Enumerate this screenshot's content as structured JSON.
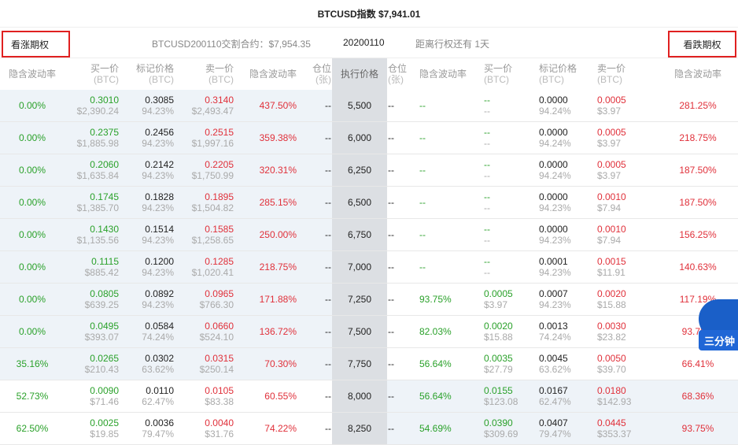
{
  "header": {
    "title": "BTCUSD指数 $7,941.01"
  },
  "sub": {
    "call_label": "看涨期权",
    "put_label": "看跌期权",
    "contract": "BTCUSD200110交割合约：$7,954.35",
    "date": "20200110",
    "remain": "距离行权还有 1天"
  },
  "columns": {
    "iv": "隐含波动率",
    "bid": "买一价",
    "bid_unit": "(BTC)",
    "mark": "标记价格",
    "mark_unit": "(BTC)",
    "ask": "卖一价",
    "ask_unit": "(BTC)",
    "iv2": "隐含波动率",
    "pos": "仓位",
    "pos_unit": "(张)",
    "strike": "执行价格"
  },
  "float": {
    "label": "三分钟"
  },
  "rows": [
    {
      "c_iv": "0.00%",
      "c_bid": "0.3010",
      "c_bid_usd": "$2,390.24",
      "c_mark": "0.3085",
      "c_mark_pct": "94.23%",
      "c_ask": "0.3140",
      "c_ask_usd": "$2,493.47",
      "c_iv2": "437.50%",
      "c_pos": "--",
      "strike": "5,500",
      "p_pos": "--",
      "p_iv": "--",
      "p_bid": "--",
      "p_bid_usd": "--",
      "p_mark": "0.0000",
      "p_mark_pct": "94.24%",
      "p_ask": "0.0005",
      "p_ask_usd": "$3.97",
      "p_iv2": "281.25%"
    },
    {
      "c_iv": "0.00%",
      "c_bid": "0.2375",
      "c_bid_usd": "$1,885.98",
      "c_mark": "0.2456",
      "c_mark_pct": "94.23%",
      "c_ask": "0.2515",
      "c_ask_usd": "$1,997.16",
      "c_iv2": "359.38%",
      "c_pos": "--",
      "strike": "6,000",
      "p_pos": "--",
      "p_iv": "--",
      "p_bid": "--",
      "p_bid_usd": "--",
      "p_mark": "0.0000",
      "p_mark_pct": "94.24%",
      "p_ask": "0.0005",
      "p_ask_usd": "$3.97",
      "p_iv2": "218.75%"
    },
    {
      "c_iv": "0.00%",
      "c_bid": "0.2060",
      "c_bid_usd": "$1,635.84",
      "c_mark": "0.2142",
      "c_mark_pct": "94.23%",
      "c_ask": "0.2205",
      "c_ask_usd": "$1,750.99",
      "c_iv2": "320.31%",
      "c_pos": "--",
      "strike": "6,250",
      "p_pos": "--",
      "p_iv": "--",
      "p_bid": "--",
      "p_bid_usd": "--",
      "p_mark": "0.0000",
      "p_mark_pct": "94.24%",
      "p_ask": "0.0005",
      "p_ask_usd": "$3.97",
      "p_iv2": "187.50%"
    },
    {
      "c_iv": "0.00%",
      "c_bid": "0.1745",
      "c_bid_usd": "$1,385.70",
      "c_mark": "0.1828",
      "c_mark_pct": "94.23%",
      "c_ask": "0.1895",
      "c_ask_usd": "$1,504.82",
      "c_iv2": "285.15%",
      "c_pos": "--",
      "strike": "6,500",
      "p_pos": "--",
      "p_iv": "--",
      "p_bid": "--",
      "p_bid_usd": "--",
      "p_mark": "0.0000",
      "p_mark_pct": "94.23%",
      "p_ask": "0.0010",
      "p_ask_usd": "$7.94",
      "p_iv2": "187.50%"
    },
    {
      "c_iv": "0.00%",
      "c_bid": "0.1430",
      "c_bid_usd": "$1,135.56",
      "c_mark": "0.1514",
      "c_mark_pct": "94.23%",
      "c_ask": "0.1585",
      "c_ask_usd": "$1,258.65",
      "c_iv2": "250.00%",
      "c_pos": "--",
      "strike": "6,750",
      "p_pos": "--",
      "p_iv": "--",
      "p_bid": "--",
      "p_bid_usd": "--",
      "p_mark": "0.0000",
      "p_mark_pct": "94.23%",
      "p_ask": "0.0010",
      "p_ask_usd": "$7.94",
      "p_iv2": "156.25%"
    },
    {
      "c_iv": "0.00%",
      "c_bid": "0.1115",
      "c_bid_usd": "$885.42",
      "c_mark": "0.1200",
      "c_mark_pct": "94.23%",
      "c_ask": "0.1285",
      "c_ask_usd": "$1,020.41",
      "c_iv2": "218.75%",
      "c_pos": "--",
      "strike": "7,000",
      "p_pos": "--",
      "p_iv": "--",
      "p_bid": "--",
      "p_bid_usd": "--",
      "p_mark": "0.0001",
      "p_mark_pct": "94.23%",
      "p_ask": "0.0015",
      "p_ask_usd": "$11.91",
      "p_iv2": "140.63%"
    },
    {
      "c_iv": "0.00%",
      "c_bid": "0.0805",
      "c_bid_usd": "$639.25",
      "c_mark": "0.0892",
      "c_mark_pct": "94.23%",
      "c_ask": "0.0965",
      "c_ask_usd": "$766.30",
      "c_iv2": "171.88%",
      "c_pos": "--",
      "strike": "7,250",
      "p_pos": "--",
      "p_iv": "93.75%",
      "p_bid": "0.0005",
      "p_bid_usd": "$3.97",
      "p_mark": "0.0007",
      "p_mark_pct": "94.23%",
      "p_ask": "0.0020",
      "p_ask_usd": "$15.88",
      "p_iv2": "117.19%"
    },
    {
      "c_iv": "0.00%",
      "c_bid": "0.0495",
      "c_bid_usd": "$393.07",
      "c_mark": "0.0584",
      "c_mark_pct": "74.24%",
      "c_ask": "0.0660",
      "c_ask_usd": "$524.10",
      "c_iv2": "136.72%",
      "c_pos": "--",
      "strike": "7,500",
      "p_pos": "--",
      "p_iv": "82.03%",
      "p_bid": "0.0020",
      "p_bid_usd": "$15.88",
      "p_mark": "0.0013",
      "p_mark_pct": "74.24%",
      "p_ask": "0.0030",
      "p_ask_usd": "$23.82",
      "p_iv2": "93.75%"
    },
    {
      "c_iv": "35.16%",
      "c_bid": "0.0265",
      "c_bid_usd": "$210.43",
      "c_mark": "0.0302",
      "c_mark_pct": "63.62%",
      "c_ask": "0.0315",
      "c_ask_usd": "$250.14",
      "c_iv2": "70.30%",
      "c_pos": "--",
      "strike": "7,750",
      "p_pos": "--",
      "p_iv": "56.64%",
      "p_bid": "0.0035",
      "p_bid_usd": "$27.79",
      "p_mark": "0.0045",
      "p_mark_pct": "63.62%",
      "p_ask": "0.0050",
      "p_ask_usd": "$39.70",
      "p_iv2": "66.41%"
    },
    {
      "c_iv": "52.73%",
      "c_bid": "0.0090",
      "c_bid_usd": "$71.46",
      "c_mark": "0.0110",
      "c_mark_pct": "62.47%",
      "c_ask": "0.0105",
      "c_ask_usd": "$83.38",
      "c_iv2": "60.55%",
      "c_pos": "--",
      "strike": "8,000",
      "p_pos": "--",
      "p_iv": "56.64%",
      "p_bid": "0.0155",
      "p_bid_usd": "$123.08",
      "p_mark": "0.0167",
      "p_mark_pct": "62.47%",
      "p_ask": "0.0180",
      "p_ask_usd": "$142.93",
      "p_iv2": "68.36%"
    },
    {
      "c_iv": "62.50%",
      "c_bid": "0.0025",
      "c_bid_usd": "$19.85",
      "c_mark": "0.0036",
      "c_mark_pct": "79.47%",
      "c_ask": "0.0040",
      "c_ask_usd": "$31.76",
      "c_iv2": "74.22%",
      "c_pos": "--",
      "strike": "8,250",
      "p_pos": "--",
      "p_iv": "54.69%",
      "p_bid": "0.0390",
      "p_bid_usd": "$309.69",
      "p_mark": "0.0407",
      "p_mark_pct": "79.47%",
      "p_ask": "0.0445",
      "p_ask_usd": "$353.37",
      "p_iv2": "93.75%"
    }
  ]
}
